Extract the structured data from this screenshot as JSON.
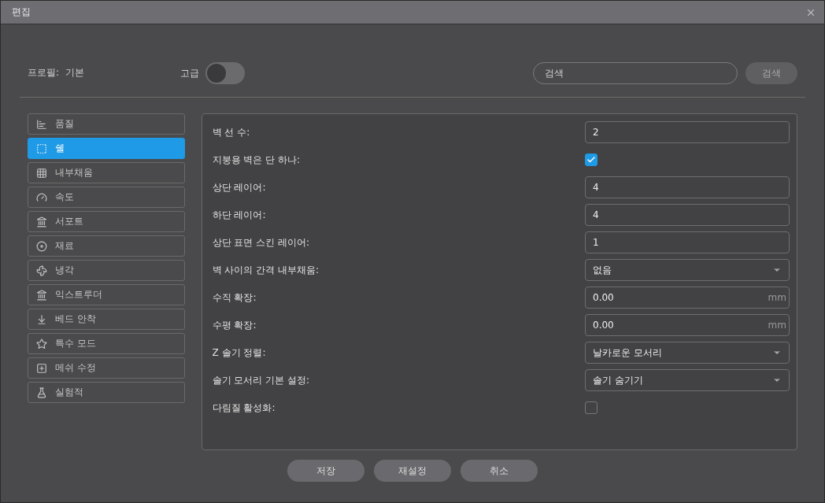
{
  "window": {
    "title": "편집"
  },
  "profile": {
    "label": "프로필:",
    "value": "기본"
  },
  "advanced": {
    "label": "고급",
    "on": false
  },
  "search": {
    "placeholder": "검색",
    "button": "검색"
  },
  "sidebar": {
    "items": [
      {
        "label": "품질",
        "selected": false
      },
      {
        "label": "쉘",
        "selected": true
      },
      {
        "label": "내부채움",
        "selected": false
      },
      {
        "label": "속도",
        "selected": false
      },
      {
        "label": "서포트",
        "selected": false
      },
      {
        "label": "재료",
        "selected": false
      },
      {
        "label": "냉각",
        "selected": false
      },
      {
        "label": "익스트루더",
        "selected": false
      },
      {
        "label": "베드 안착",
        "selected": false
      },
      {
        "label": "특수 모드",
        "selected": false
      },
      {
        "label": "메쉬 수정",
        "selected": false
      },
      {
        "label": "실험적",
        "selected": false
      }
    ]
  },
  "settings": [
    {
      "label": "벽 선 수:",
      "kind": "number",
      "value": "2"
    },
    {
      "label": "지붕용 벽은 단 하나:",
      "kind": "checkbox",
      "checked": true
    },
    {
      "label": "상단 레이어:",
      "kind": "number",
      "value": "4"
    },
    {
      "label": "하단 레이어:",
      "kind": "number",
      "value": "4"
    },
    {
      "label": "상단 표면 스킨 레이어:",
      "kind": "number",
      "value": "1"
    },
    {
      "label": "벽 사이의 간격 내부채움:",
      "kind": "select",
      "value": "없음"
    },
    {
      "label": "수직 확장:",
      "kind": "unit",
      "value": "0.00",
      "unit": "mm"
    },
    {
      "label": "수평 확장:",
      "kind": "unit",
      "value": "0.00",
      "unit": "mm"
    },
    {
      "label": "Z 솔기 정렬:",
      "kind": "select",
      "value": "날카로운 모서리"
    },
    {
      "label": "솔기 모서리 기본 설정:",
      "kind": "select",
      "value": "솔기 숨기기"
    },
    {
      "label": "다림질 활성화:",
      "kind": "checkbox",
      "checked": false
    }
  ],
  "buttons": [
    "저장",
    "재설정",
    "취소"
  ]
}
